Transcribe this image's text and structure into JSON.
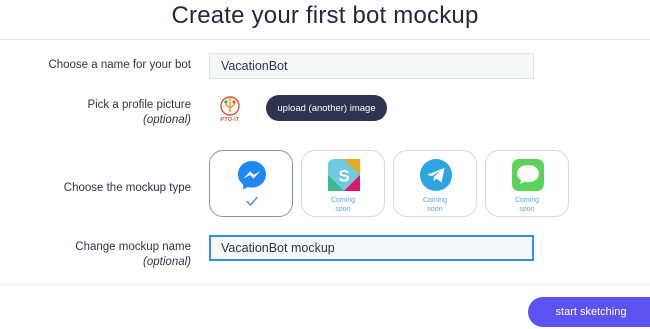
{
  "header": {
    "title": "Create your first bot mockup"
  },
  "form": {
    "name": {
      "label": "Choose a name for your bot",
      "value": "VacationBot"
    },
    "picture": {
      "label": "Pick a profile picture",
      "sublabel": "(optional)",
      "avatar_text": "PTO-IT",
      "upload_label": "upload (another) image"
    },
    "mockup_type": {
      "label": "Choose the mockup type",
      "options": [
        {
          "id": "messenger",
          "icon": "messenger-icon",
          "status": "selected",
          "color": "#1e88f5"
        },
        {
          "id": "slack",
          "icon": "slack-icon",
          "status_text": "Coming soon",
          "color": "#6ecadc"
        },
        {
          "id": "telegram",
          "icon": "telegram-icon",
          "status_text": "Coming soon",
          "color": "#2ca5e0"
        },
        {
          "id": "imessage",
          "icon": "imessage-icon",
          "status_text": "Coming soon",
          "color": "#5bd25a"
        }
      ]
    },
    "mockup_name": {
      "label": "Change mockup name",
      "sublabel": "(optional)",
      "value": "VacationBot mockup"
    }
  },
  "footer": {
    "start_label": "start sketching"
  },
  "colors": {
    "primary_dark": "#2e3350",
    "accent": "#5b52f0",
    "focus": "#2f8ff0",
    "link": "#5aa4e8"
  }
}
